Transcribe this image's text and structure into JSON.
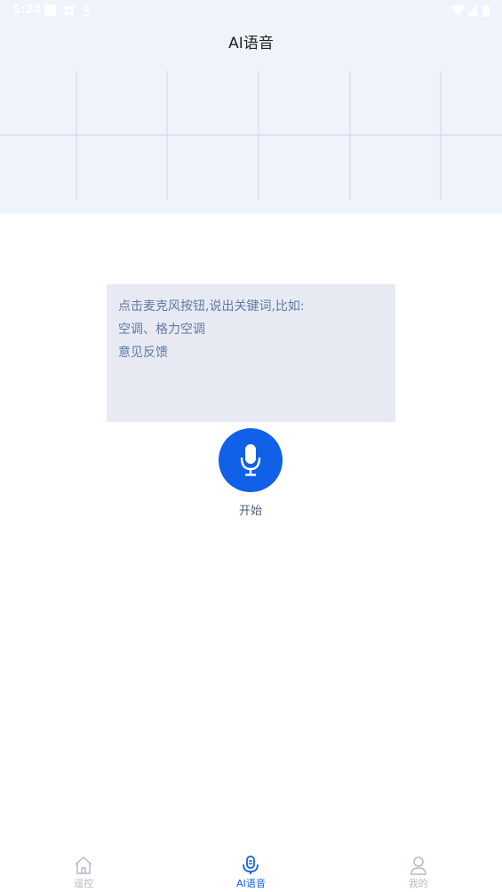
{
  "status_bar": {
    "time": "5:24",
    "left_icons": [
      "square-icon",
      "notification-icon",
      "download-icon"
    ],
    "right_icons": [
      "wifi-icon",
      "signal-icon",
      "battery-icon"
    ]
  },
  "header": {
    "title": "AI语音"
  },
  "hint": {
    "lines": [
      "点击麦克风按钮,说出关键词,比如:",
      "空调、格力空调",
      "意见反馈"
    ]
  },
  "mic": {
    "label": "开始",
    "icon": "microphone-icon"
  },
  "bottom_nav": {
    "items": [
      {
        "label": "遥控",
        "icon": "home-icon",
        "active": false
      },
      {
        "label": "AI语音",
        "icon": "voice-icon",
        "active": true
      },
      {
        "label": "我的",
        "icon": "person-icon",
        "active": false
      }
    ]
  },
  "colors": {
    "header_bg": "#eff3fc",
    "accent": "#1160e8",
    "hint_bg": "#e8eaf3",
    "hint_text": "#5f79a6",
    "nav_inactive": "#b4bac6"
  }
}
